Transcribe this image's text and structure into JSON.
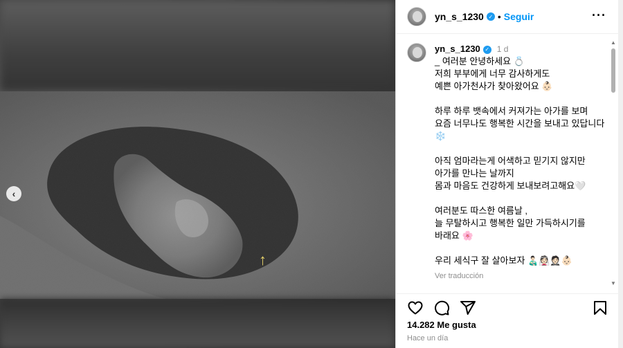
{
  "post": {
    "username": "yn_s_1230",
    "verified": true,
    "follow_label": "Seguir",
    "dot": "•",
    "more_label": "···"
  },
  "caption": {
    "username": "yn_s_1230",
    "time": "1 d",
    "lines": [
      "_ 여러분 안녕하세요 💍",
      "저희 부부에게 너무 감사하게도",
      "예쁜 아가천사가 찾아왔어요 👶🏻",
      "",
      "하루 하루 뱃속에서 커져가는 아가를 보며",
      "요즘 너무나도 행복한 시간을 보내고 있답니다 ❄️",
      "",
      "아직 엄마라는게 어색하고 믿기지 않지만",
      "아가를 만나는 날까지",
      "몸과 마음도 건강하게 보내보려고해요🤍",
      "",
      "여러분도 따스한 여름날 ,",
      "늘 무탈하시고 행복한 일만 가득하시기를 바래요 🌸",
      "",
      "우리 세식구 잘 살아보자 👨🏻‍🍼👰🏻🤵🏻👶🏻"
    ],
    "translate_label": "Ver traducción"
  },
  "engagement": {
    "likes_text": "14.282 Me gusta",
    "ago_text": "Hace un día"
  },
  "media": {
    "prev_glyph": "‹",
    "arrow_glyph": "↑"
  },
  "icons": {
    "like": "heart-icon",
    "comment": "comment-icon",
    "share": "share-icon",
    "save": "bookmark-icon",
    "more": "more-options-icon",
    "prev": "chevron-left-icon"
  },
  "colors": {
    "accent": "#0095f6",
    "verified": "#1d9bf0",
    "muted": "#8e8e8e"
  }
}
